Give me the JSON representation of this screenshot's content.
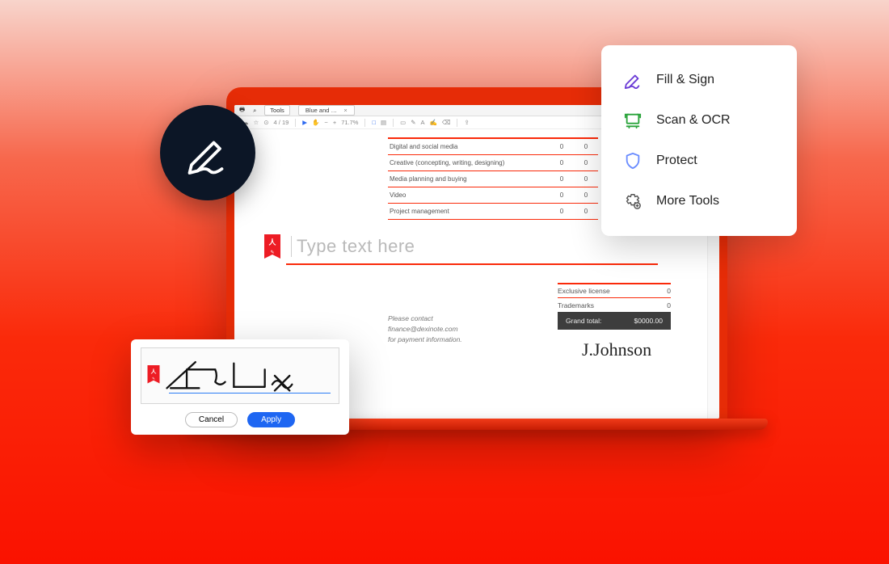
{
  "laptop": {
    "tools_link": "Tools",
    "tab_label": "Blue and White Ill...",
    "pagecounter": "4 / 19",
    "zoom": "71.7%",
    "toolbar_tools": [
      "print",
      "zoom-out",
      "hand",
      "selection",
      "zoom-in",
      "page-prev",
      "page-next",
      "fit-width",
      "fit-page",
      "cursor",
      "rect",
      "circle",
      "line",
      "arrow",
      "highlight",
      "note",
      "stamp",
      "text",
      "eraser",
      "signature",
      "share"
    ]
  },
  "doc": {
    "table_rows": [
      {
        "label": "Digital and social media",
        "v1": "0",
        "v2": "0"
      },
      {
        "label": "Creative (concepting, writing, designing)",
        "v1": "0",
        "v2": "0"
      },
      {
        "label": "Media planning and buying",
        "v1": "0",
        "v2": "0"
      },
      {
        "label": "Video",
        "v1": "0",
        "v2": "0"
      },
      {
        "label": "Project management",
        "v1": "0",
        "v2": "0"
      }
    ],
    "type_placeholder": "Type text here",
    "mini": [
      {
        "label": "Exclusive license",
        "value": "0"
      },
      {
        "label": "Trademarks",
        "value": "0"
      }
    ],
    "grand_label": "Grand total:",
    "grand_value": "$0000.00",
    "contact_line1": "Please contact",
    "contact_line2": "finance@dexinote.com",
    "contact_line3": "for payment information.",
    "signature_preview": "J.Johnson"
  },
  "tools_card": {
    "items": [
      {
        "icon": "fill-sign-icon",
        "label": "Fill & Sign",
        "color": "#6b3bd6"
      },
      {
        "icon": "scan-ocr-icon",
        "label": "Scan & OCR",
        "color": "#29a33a"
      },
      {
        "icon": "protect-icon",
        "label": "Protect",
        "color": "#6a8cff"
      },
      {
        "icon": "more-tools-icon",
        "label": "More Tools",
        "color": "#555"
      }
    ]
  },
  "signature_modal": {
    "drawn_name": "Zac Fox",
    "cancel": "Cancel",
    "apply": "Apply"
  }
}
